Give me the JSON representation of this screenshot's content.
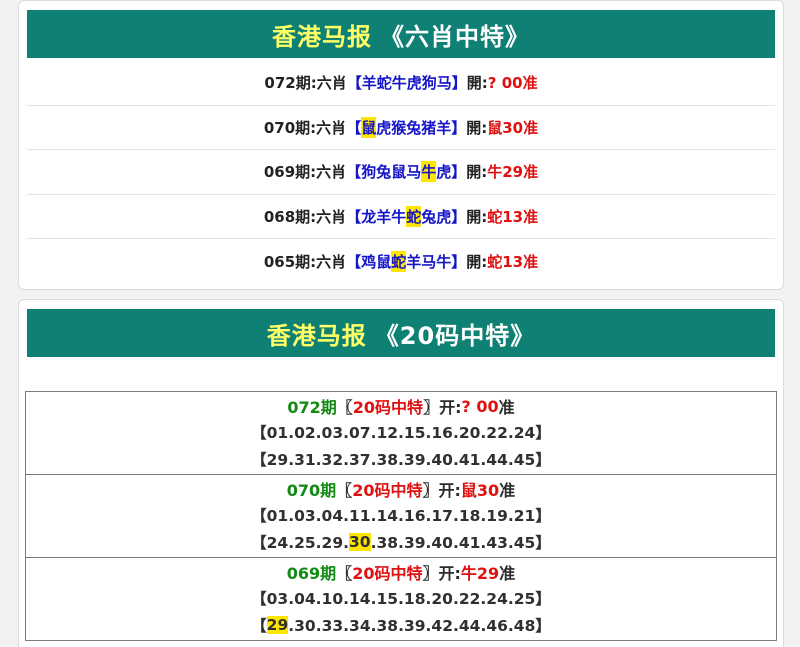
{
  "section1": {
    "title_part1": "香港马报",
    "title_part2": "《六肖中特》",
    "rows": [
      {
        "period": "072期:六肖",
        "bracket_open": "【",
        "before": "羊蛇牛虎狗马",
        "hit": "",
        "after": "",
        "bracket_close": "】",
        "open_label": "開:",
        "result": "? 00准"
      },
      {
        "period": "070期:六肖",
        "bracket_open": "【",
        "before": "",
        "hit": "鼠",
        "after": "虎猴兔猪羊",
        "bracket_close": "】",
        "open_label": "開:",
        "result": "鼠30准"
      },
      {
        "period": "069期:六肖",
        "bracket_open": "【",
        "before": "狗兔鼠马",
        "hit": "牛",
        "after": "虎",
        "bracket_close": "】",
        "open_label": "開:",
        "result": "牛29准"
      },
      {
        "period": "068期:六肖",
        "bracket_open": "【",
        "before": "龙羊牛",
        "hit": "蛇",
        "after": "兔虎",
        "bracket_close": "】",
        "open_label": "開:",
        "result": "蛇13准"
      },
      {
        "period": "065期:六肖",
        "bracket_open": "【",
        "before": "鸡鼠",
        "hit": "蛇",
        "after": "羊马牛",
        "bracket_close": "】",
        "open_label": "開:",
        "result": "蛇13准"
      }
    ]
  },
  "section2": {
    "title_part1": "香港马报",
    "title_part2": "《20码中特》",
    "blocks": [
      {
        "period": "072期",
        "tag_open": "〖",
        "tag": "20码中特",
        "tag_close": "〗",
        "open_label": "开:",
        "result_value": "? 00",
        "result_suffix": "准",
        "line1": "【01.02.03.07.12.15.16.20.22.24】",
        "line2_before": "【29.31.32.37.38.39.40.41.44.45】",
        "line2_hit": "",
        "line2_after": ""
      },
      {
        "period": "070期",
        "tag_open": "〖",
        "tag": "20码中特",
        "tag_close": "〗",
        "open_label": "开:",
        "result_value": "鼠30",
        "result_suffix": "准",
        "line1": "【01.03.04.11.14.16.17.18.19.21】",
        "line2_before": "【24.25.29.",
        "line2_hit": "30",
        "line2_after": ".38.39.40.41.43.45】"
      },
      {
        "period": "069期",
        "tag_open": "〖",
        "tag": "20码中特",
        "tag_close": "〗",
        "open_label": "开:",
        "result_value": "牛29",
        "result_suffix": "准",
        "line1": "【03.04.10.14.15.18.20.22.24.25】",
        "line2_before": "【",
        "line2_hit": "29",
        "line2_after": ".30.33.34.38.39.42.44.46.48】"
      }
    ]
  }
}
